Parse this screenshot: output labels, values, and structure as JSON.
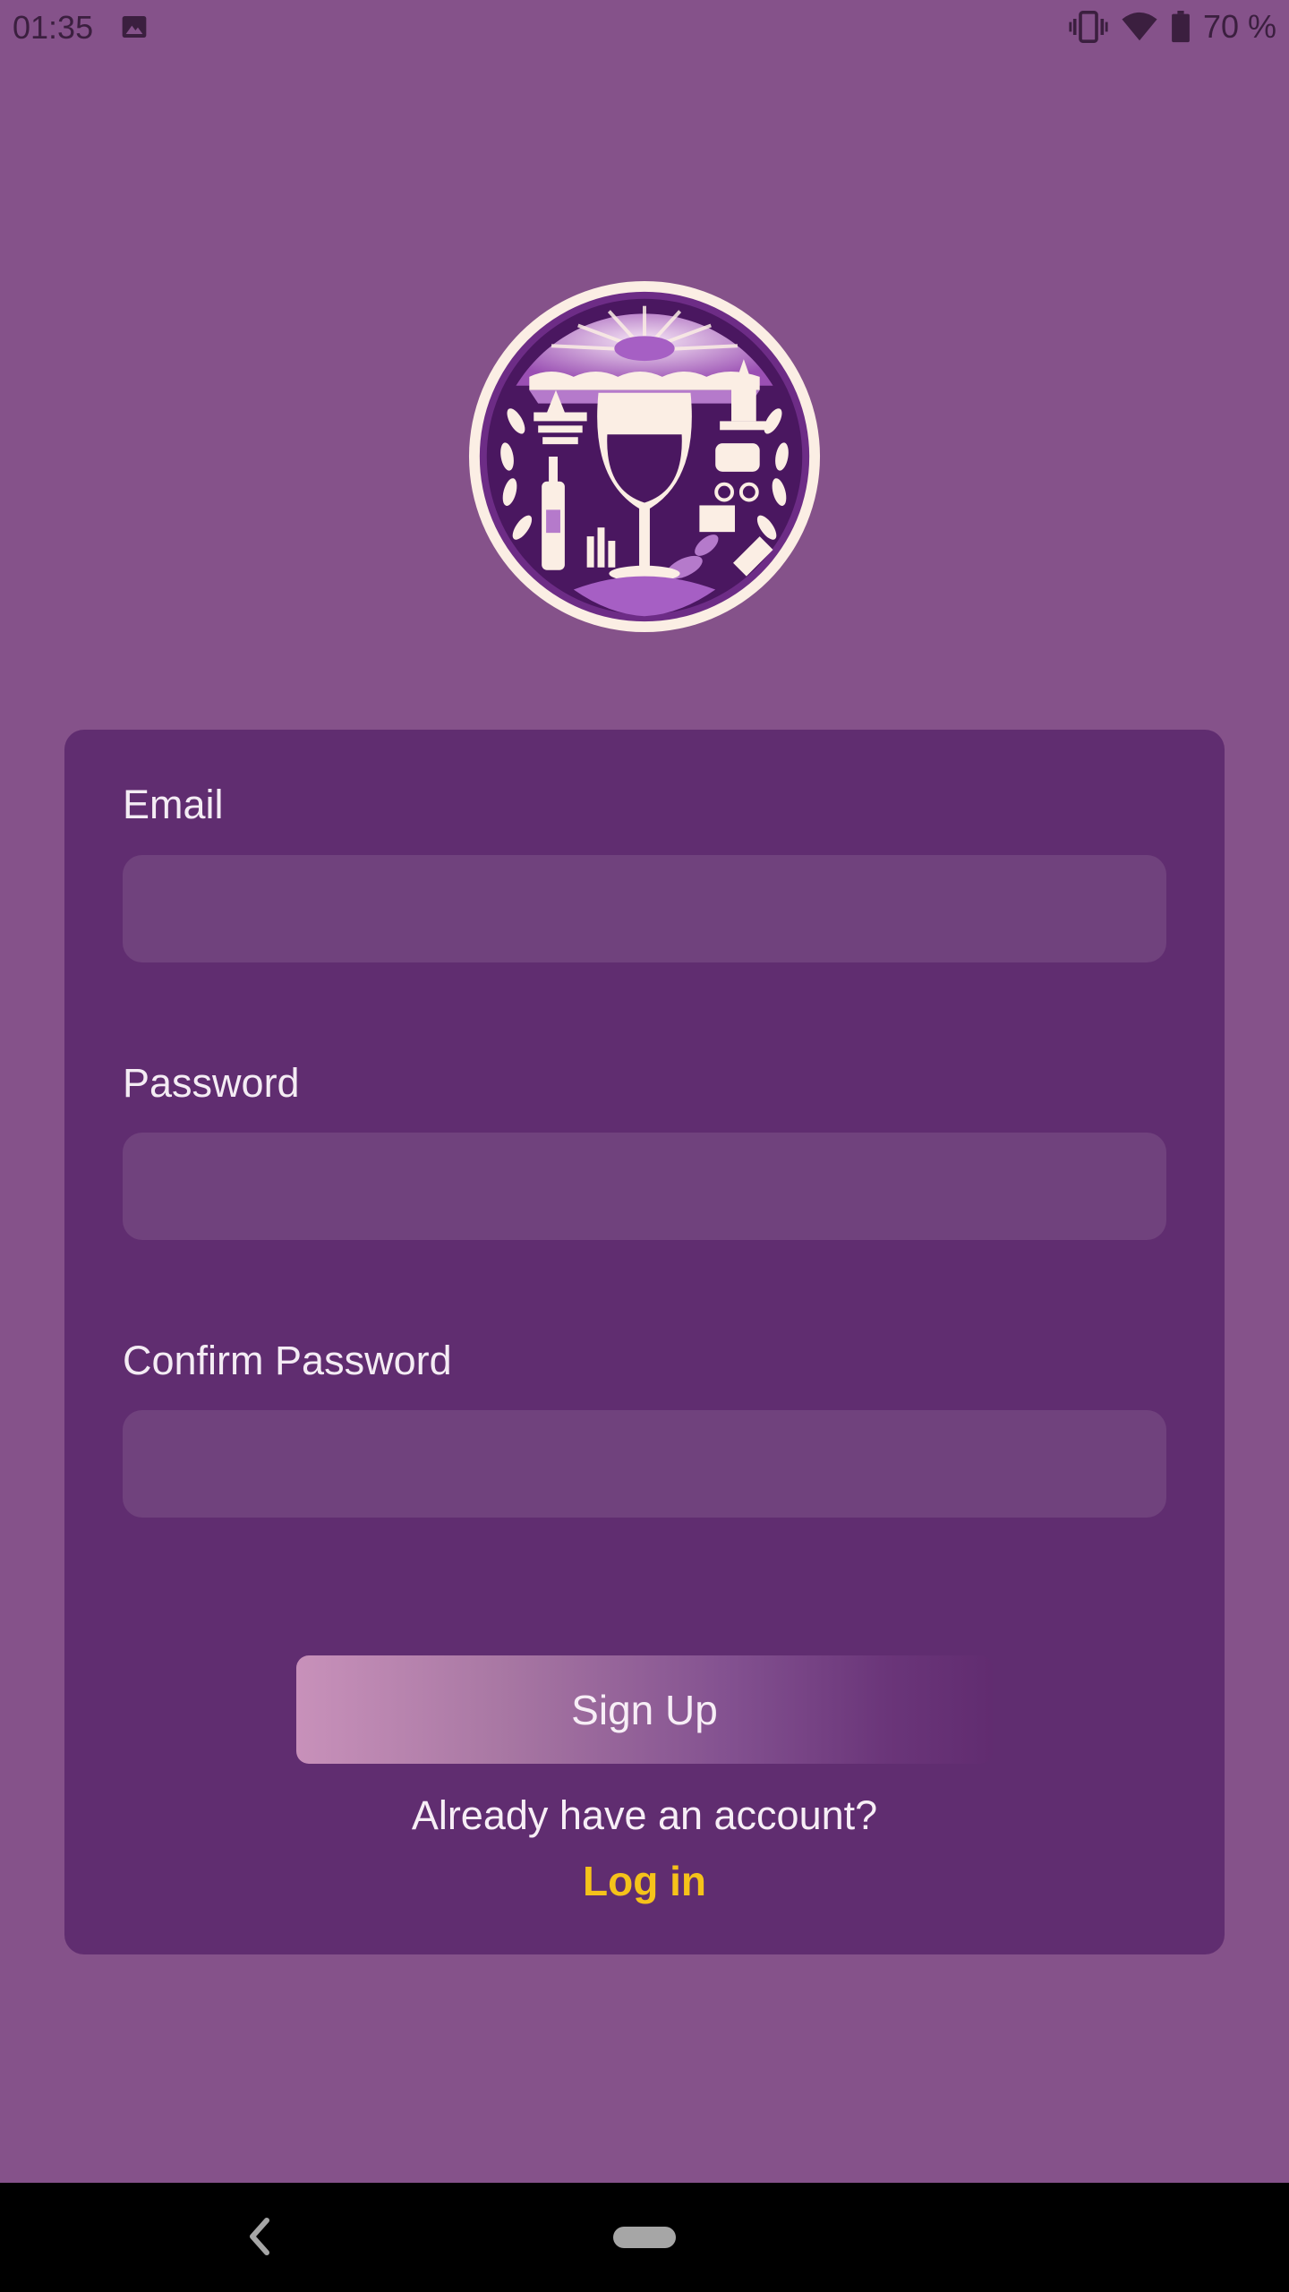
{
  "status_bar": {
    "time": "01:35",
    "battery_text": "70 %",
    "icons": [
      "gallery-icon",
      "vibrate-icon",
      "wifi-icon",
      "battery-icon"
    ]
  },
  "logo": {
    "icon": "wine-glass-emblem-logo"
  },
  "form": {
    "email": {
      "label": "Email",
      "value": "",
      "placeholder": ""
    },
    "password": {
      "label": "Password",
      "value": "",
      "placeholder": ""
    },
    "confirm_password": {
      "label": "Confirm Password",
      "value": "",
      "placeholder": ""
    },
    "signup_label": "Sign Up",
    "already_text": "Already have an account?",
    "login_label": "Log in"
  },
  "nav_bar": {
    "icons": [
      "back-icon",
      "home-pill"
    ]
  },
  "colors": {
    "background": "#85528a",
    "card": "#602d70",
    "input": "#70427d",
    "accent_link": "#f5c21a",
    "button_gradient_start": "#c891ba",
    "button_gradient_end": "#612c70"
  }
}
